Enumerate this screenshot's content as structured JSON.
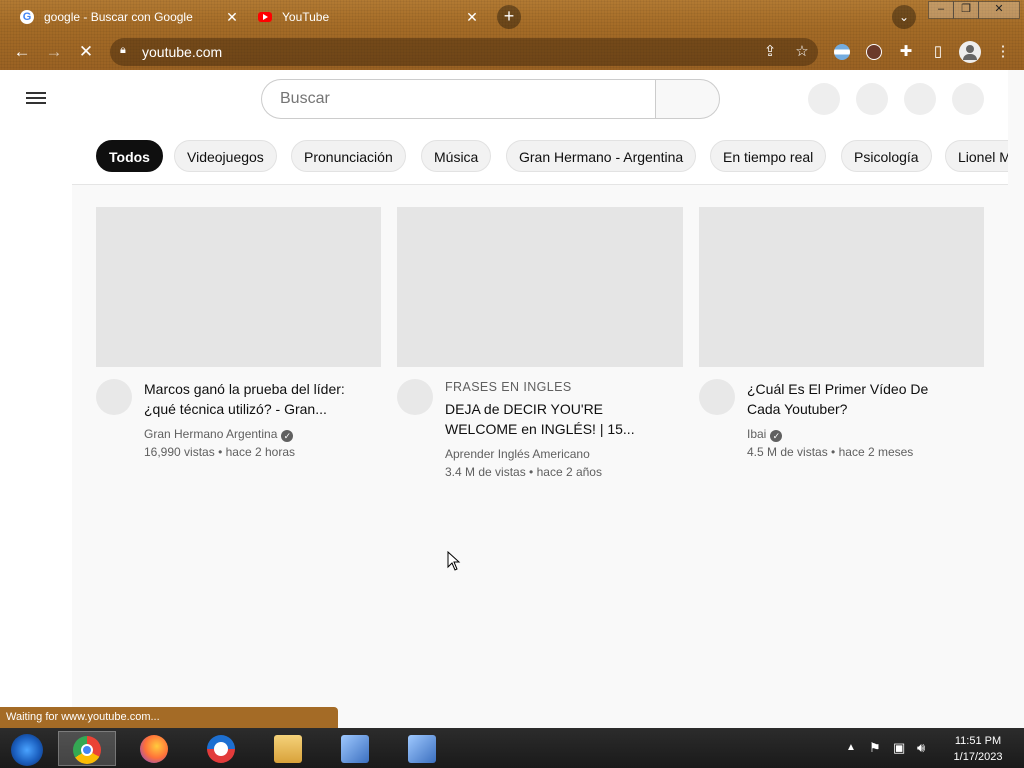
{
  "browser": {
    "tabs": [
      {
        "title": "google - Buscar con Google"
      },
      {
        "title": "YouTube"
      }
    ],
    "close_glyph": "✕",
    "new_tab_glyph": "+",
    "url": "youtube.com",
    "status": "Waiting for www.youtube.com..."
  },
  "youtube": {
    "search_placeholder": "Buscar",
    "chips": [
      "Todos",
      "Videojuegos",
      "Pronunciación",
      "Música",
      "Gran Hermano - Argentina",
      "En tiempo real",
      "Psicología",
      "Lionel M"
    ],
    "videos": [
      {
        "tag": "",
        "title_line1": "Marcos ganó la prueba del líder:",
        "title_line2": "¿qué técnica utilizó? - Gran...",
        "channel": "Gran Hermano Argentina",
        "verified": true,
        "views": "16,990 vistas",
        "age": "hace 2 horas"
      },
      {
        "tag": "FRASES EN INGLES",
        "title_line1": "DEJA de DECIR YOU'RE",
        "title_line2": "WELCOME en INGLÉS! | 15...",
        "channel": "Aprender Inglés Americano",
        "verified": false,
        "views": "3.4 M de vistas",
        "age": "hace 2 años"
      },
      {
        "tag": "",
        "title_line1": "¿Cuál Es El Primer Vídeo De",
        "title_line2": "Cada Youtuber?",
        "channel": "Ibai",
        "verified": true,
        "views": "4.5 M de vistas",
        "age": "hace 2 meses"
      }
    ],
    "meta_separator": "•"
  },
  "taskbar": {
    "time": "11:51 PM",
    "date": "1/17/2023"
  },
  "icons": [
    "google-favicon",
    "youtube-favicon",
    "back-icon",
    "forward-icon",
    "loading-icon",
    "lock-icon",
    "share-icon",
    "star-icon",
    "extension-icon",
    "profile-icon",
    "menu-icon"
  ]
}
